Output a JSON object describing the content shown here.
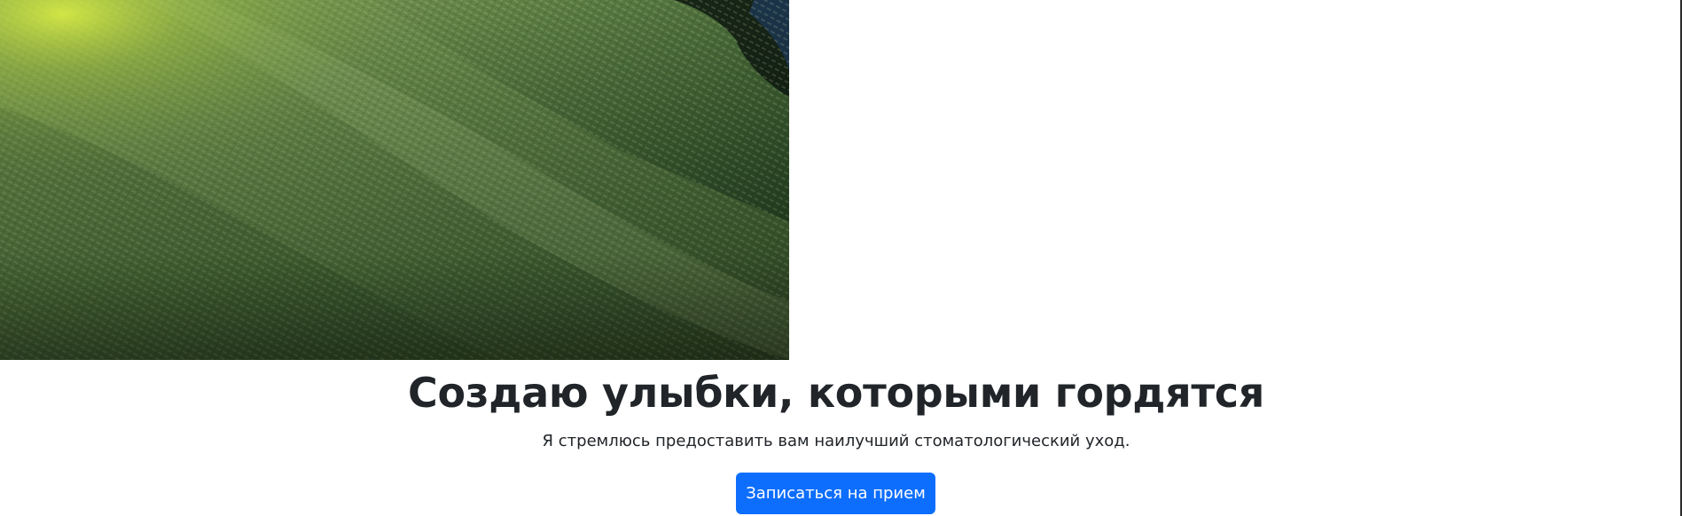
{
  "hero": {
    "image_icon": "green-fabric-photo",
    "title": "Создаю улыбки, которыми гордятся",
    "subtitle": "Я стремлюсь предоставить вам наилучший стоматологический уход.",
    "cta_label": "Записаться на прием"
  },
  "colors": {
    "primary": "#0d6efd",
    "text": "#212529",
    "background": "#ffffff"
  }
}
